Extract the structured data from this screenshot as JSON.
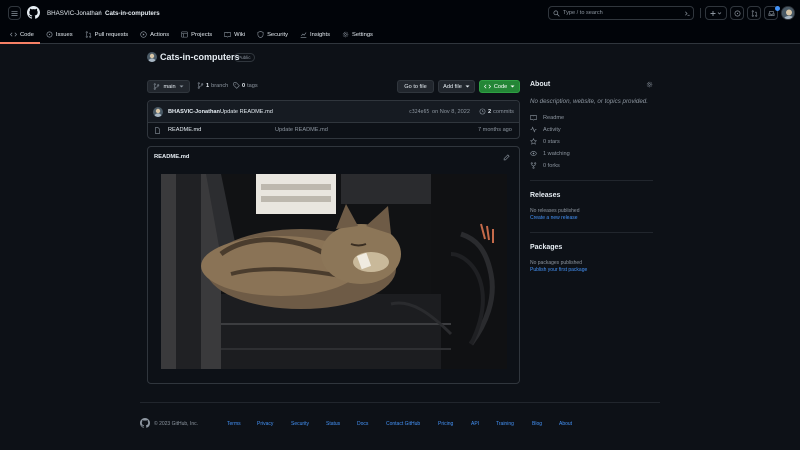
{
  "header": {
    "owner": "BHASVIC-Jonathan",
    "separator": "/",
    "repo": "Cats-in-computers",
    "search_text": "Type / to search",
    "tabs": [
      {
        "label": "Code"
      },
      {
        "label": "Issues"
      },
      {
        "label": "Pull requests"
      },
      {
        "label": "Actions"
      },
      {
        "label": "Projects"
      },
      {
        "label": "Wiki"
      },
      {
        "label": "Security"
      },
      {
        "label": "Insights"
      },
      {
        "label": "Settings"
      }
    ]
  },
  "repo": {
    "title": "Cats-in-computers",
    "visibility": "Public",
    "branch": "main",
    "branch_count": "1",
    "branch_label": "branch",
    "tag_count": "0",
    "tag_label": "tags",
    "go_to_file": "Go to file",
    "add_file": "Add file",
    "code": "Code"
  },
  "commit": {
    "author": "BHASVIC-Jonathan",
    "message": "Update README.md",
    "hash": "c324e65",
    "date": "on Nov 8, 2022",
    "count": "2",
    "count_label": "commits"
  },
  "files": [
    {
      "name": "README.md",
      "message": "Update README.md",
      "age": "7 months ago"
    }
  ],
  "readme": {
    "title": "README.md"
  },
  "about": {
    "heading": "About",
    "description": "No description, website, or topics provided.",
    "items": [
      {
        "icon": "book-icon",
        "label": "Readme"
      },
      {
        "icon": "pulse-icon",
        "label": "Activity"
      },
      {
        "icon": "star-icon",
        "label": "0 stars"
      },
      {
        "icon": "eye-icon",
        "label": "1 watching"
      },
      {
        "icon": "fork-icon",
        "label": "0 forks"
      }
    ]
  },
  "releases": {
    "heading": "Releases",
    "empty": "No releases published",
    "link": "Create a new release"
  },
  "packages": {
    "heading": "Packages",
    "empty": "No packages published",
    "link": "Publish your first package"
  },
  "footer": {
    "copyright": "© 2023 GitHub, Inc.",
    "links": [
      "Terms",
      "Privacy",
      "Security",
      "Status",
      "Docs",
      "Contact GitHub",
      "Pricing",
      "API",
      "Training",
      "Blog",
      "About"
    ]
  },
  "colors": {
    "bg": "#0d1117",
    "header_bg": "#010409",
    "border": "#30363d",
    "accent_link": "#4493f8",
    "green_button": "#238636",
    "tab_underline": "#f78166"
  }
}
